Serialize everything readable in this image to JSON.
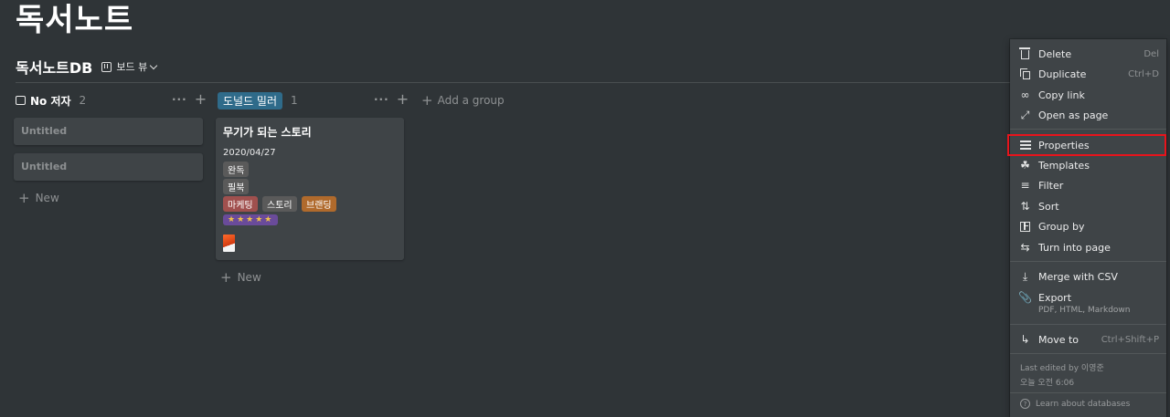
{
  "page": {
    "title": "독서노트"
  },
  "database": {
    "title": "독서노트DB",
    "view_label": "보드 뷰"
  },
  "groups": [
    {
      "label": "No 저자",
      "count": "2"
    },
    {
      "label": "도널드 밀러",
      "count": "1"
    }
  ],
  "add_group_label": "Add a group",
  "new_label": "New",
  "untitled_cards": [
    "Untitled",
    "Untitled"
  ],
  "book_card": {
    "title": "무기가 되는 스토리",
    "date": "2020/04/27",
    "status": "완독",
    "format": "필북",
    "tags": [
      "마케팅",
      "스토리",
      "브랜딩"
    ],
    "rating": "★★★★★"
  },
  "menu": {
    "items": [
      {
        "label": "Delete",
        "shortcut": "Del",
        "icon": "trash-icon"
      },
      {
        "label": "Duplicate",
        "shortcut": "Ctrl+D",
        "icon": "duplicate-icon"
      },
      {
        "label": "Copy link",
        "shortcut": "",
        "icon": "link-icon"
      },
      {
        "label": "Open as page",
        "shortcut": "",
        "icon": "expand-icon"
      },
      {
        "label": "Properties",
        "shortcut": "",
        "icon": "list-icon"
      },
      {
        "label": "Templates",
        "shortcut": "",
        "icon": "templates-icon"
      },
      {
        "label": "Filter",
        "shortcut": "",
        "icon": "filter-icon"
      },
      {
        "label": "Sort",
        "shortcut": "",
        "icon": "sort-icon"
      },
      {
        "label": "Group by",
        "shortcut": "",
        "icon": "group-icon"
      },
      {
        "label": "Turn into page",
        "shortcut": "",
        "icon": "turn-into-icon"
      },
      {
        "label": "Merge with CSV",
        "shortcut": "",
        "icon": "merge-icon"
      },
      {
        "label": "Export",
        "shortcut": "",
        "icon": "export-icon"
      },
      {
        "label": "Move to",
        "shortcut": "Ctrl+Shift+P",
        "icon": "move-icon"
      }
    ],
    "export_sub": "PDF, HTML, Markdown",
    "last_edited": "Last edited by 이영준",
    "edited_time": "오늘 오전 6:06",
    "learn": "Learn about databases"
  },
  "colors": {
    "background": "#2f3437",
    "card": "#3f4447",
    "highlight": "#e8141c",
    "group_pill": "#2f6b8a"
  }
}
